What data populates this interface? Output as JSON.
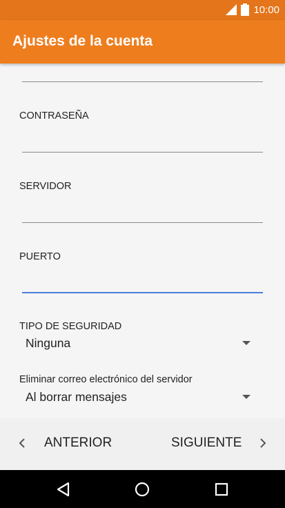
{
  "status_bar": {
    "time": "10:00",
    "signal_icon": "signal-icon",
    "battery_icon": "battery-icon"
  },
  "app_bar": {
    "title": "Ajustes de la cuenta"
  },
  "form": {
    "password_label": "CONTRASEÑA",
    "server_label": "SERVIDOR",
    "port_label": "PUERTO",
    "security_label": "TIPO DE SEGURIDAD",
    "security_value": "Ninguna",
    "delete_label": "Eliminar correo electrónico del servidor",
    "delete_value": "Al borrar mensajes"
  },
  "footer": {
    "prev_label": "ANTERIOR",
    "next_label": "SIGUIENTE"
  },
  "colors": {
    "status_bar": "#e4751b",
    "app_bar": "#ee7d1e",
    "focus_line": "#4a7ddc"
  }
}
